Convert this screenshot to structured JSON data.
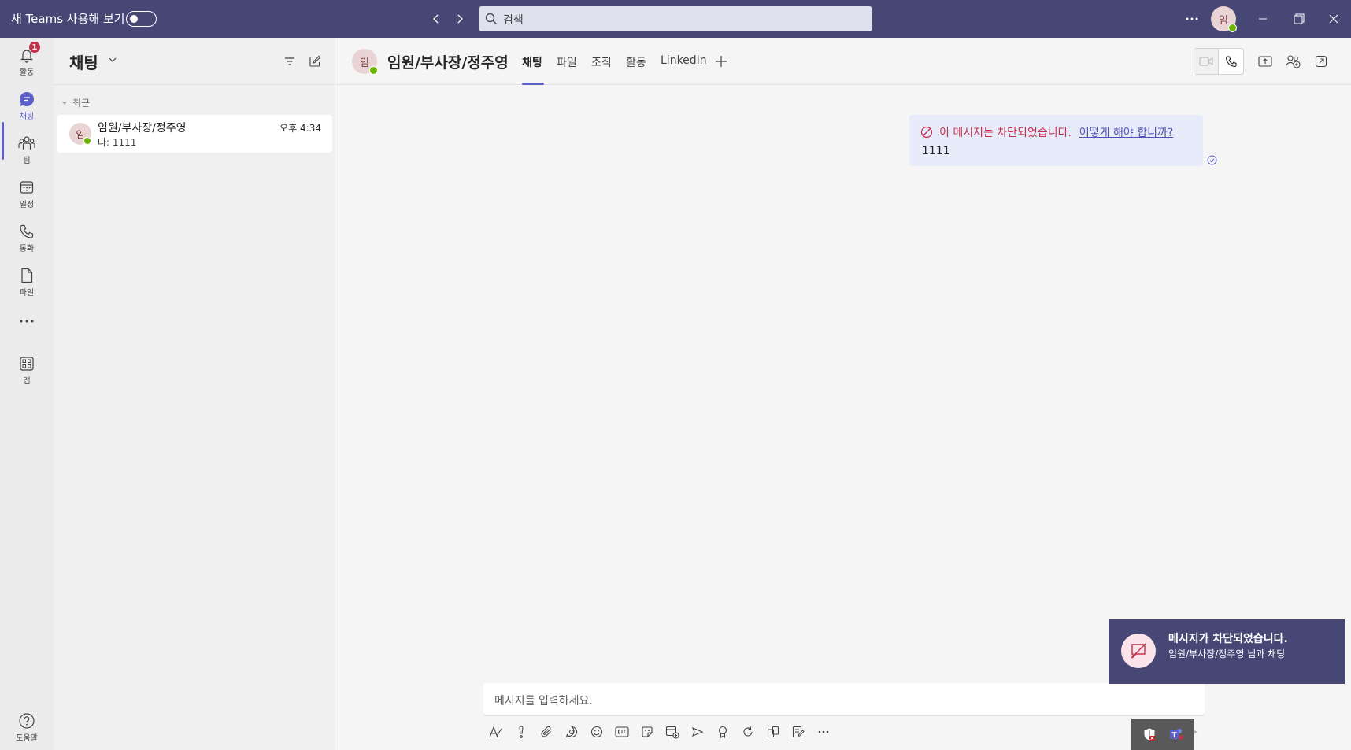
{
  "titlebar": {
    "new_teams_label": "새 Teams 사용해 보기",
    "search_placeholder": "검색",
    "avatar_initial": "임"
  },
  "rail": {
    "activity": {
      "label": "활동",
      "badge": "1"
    },
    "chat": {
      "label": "채팅"
    },
    "teams": {
      "label": "팀"
    },
    "calendar": {
      "label": "일정"
    },
    "calls": {
      "label": "통화"
    },
    "files": {
      "label": "파일"
    },
    "apps": {
      "label": "앱"
    },
    "help": {
      "label": "도움말"
    }
  },
  "chatlist": {
    "title": "채팅",
    "section_recent": "최근",
    "items": [
      {
        "avatar_initial": "임",
        "name": "임원/부사장/정주영",
        "preview": "나: 1111",
        "time": "오후 4:34"
      }
    ]
  },
  "main": {
    "avatar_initial": "임",
    "chat_name": "임원/부사장/정주영",
    "tabs": [
      {
        "label": "채팅",
        "active": true
      },
      {
        "label": "파일"
      },
      {
        "label": "조직"
      },
      {
        "label": "활동"
      },
      {
        "label": "LinkedIn"
      }
    ]
  },
  "message": {
    "blocked_text": "이 메시지는 차단되었습니다.",
    "blocked_link": "어떻게 해야 합니까?",
    "body": "1111"
  },
  "compose": {
    "placeholder": "메시지를 입력하세요."
  },
  "toast": {
    "title": "메시지가 차단되었습니다.",
    "subtitle": "임원/부사장/정주영 님과 채팅"
  },
  "colors": {
    "titlebar": "#464775",
    "accent": "#5b5fc7",
    "blocked": "#c4314b",
    "presence": "#6bb700"
  }
}
